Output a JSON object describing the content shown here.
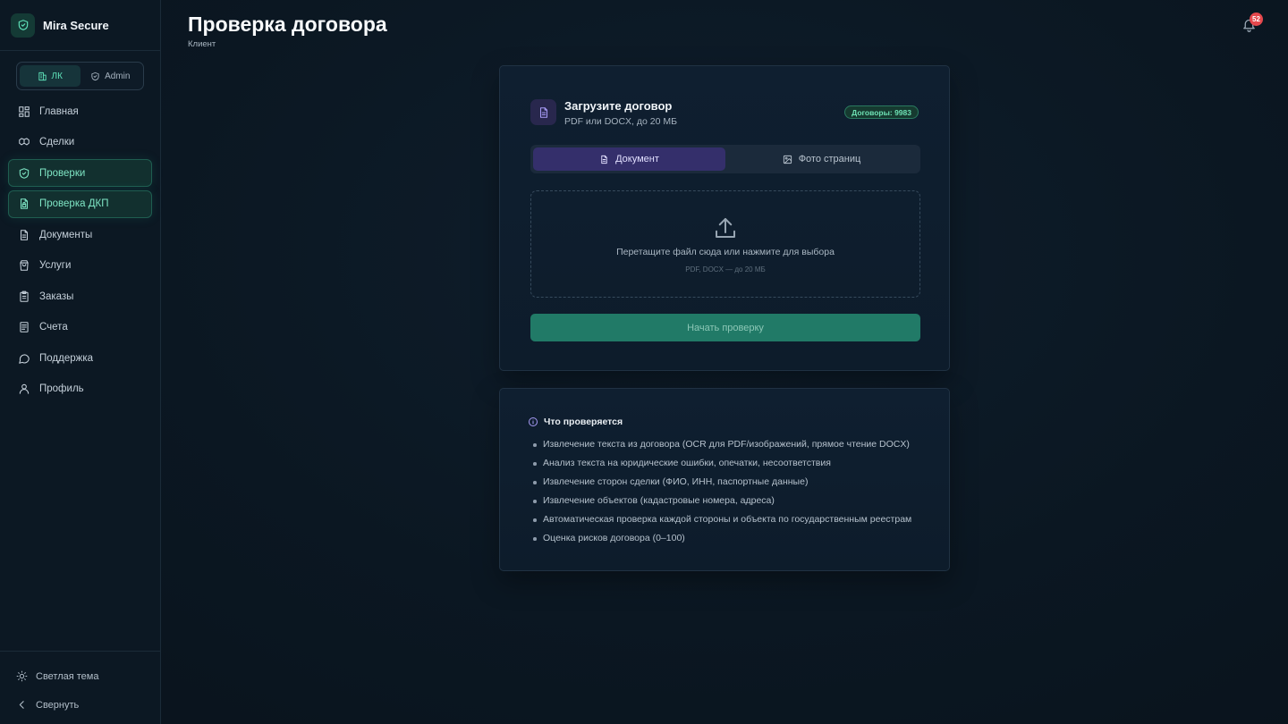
{
  "brand": {
    "name": "Mira Secure"
  },
  "switcher": {
    "lk": "ЛК",
    "admin": "Admin"
  },
  "nav": {
    "items": [
      {
        "label": "Главная"
      },
      {
        "label": "Сделки"
      },
      {
        "label": "Проверки"
      },
      {
        "label": "Проверка ДКП"
      },
      {
        "label": "Документы"
      },
      {
        "label": "Услуги"
      },
      {
        "label": "Заказы"
      },
      {
        "label": "Счета"
      },
      {
        "label": "Поддержка"
      },
      {
        "label": "Профиль"
      }
    ]
  },
  "sidebar_bottom": {
    "theme": "Светлая тема",
    "collapse": "Свернуть"
  },
  "header": {
    "title": "Проверка договора",
    "subtitle": "Клиент",
    "notifications": "52"
  },
  "upload": {
    "title": "Загрузите договор",
    "subtitle": "PDF или DOCX, до 20 МБ",
    "count_badge": "Договоры: 9983",
    "tab_document": "Документ",
    "tab_photos": "Фото страниц",
    "drop_text": "Перетащите файл сюда или нажмите для выбора",
    "drop_hint": "PDF, DOCX — до 20 МБ",
    "start_button": "Начать проверку"
  },
  "info": {
    "title": "Что проверяется",
    "items": [
      "Извлечение текста из договора (OCR для PDF/изображений, прямое чтение DOCX)",
      "Анализ текста на юридические ошибки, опечатки, несоответствия",
      "Извлечение сторон сделки (ФИО, ИНН, паспортные данные)",
      "Извлечение объектов (кадастровые номера, адреса)",
      "Автоматическая проверка каждой стороны и объекта по государственным реестрам",
      "Оценка рисков договора (0–100)"
    ]
  },
  "colors": {
    "accent": "#5ee0b8",
    "primary_button": "#217a67",
    "tab_active": "#342f6b",
    "badge_red": "#e5484d"
  }
}
